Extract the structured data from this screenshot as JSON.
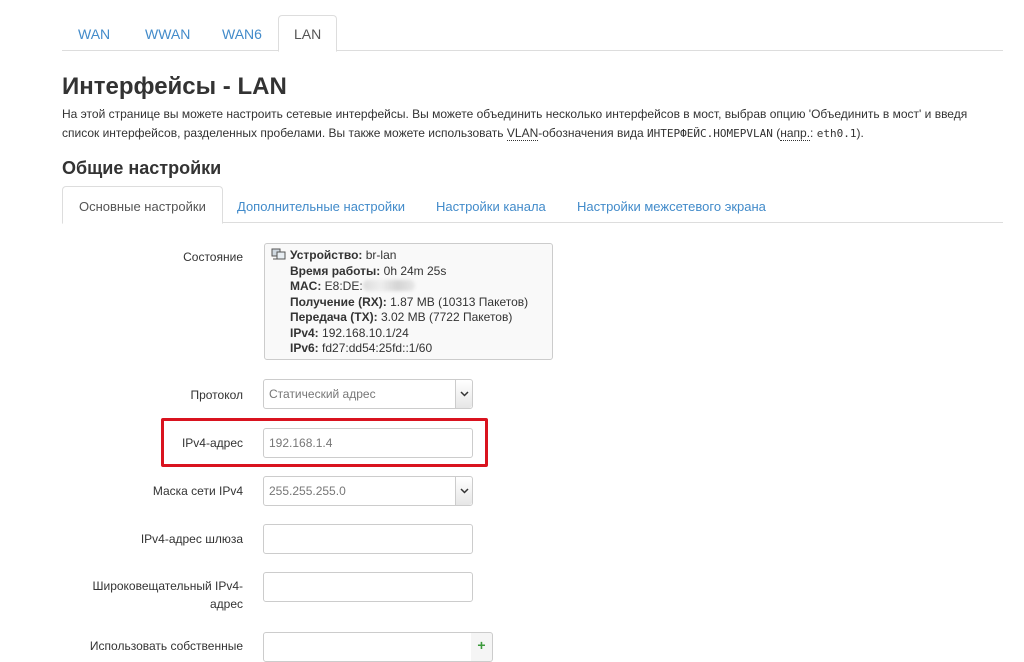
{
  "top_tabs": [
    "WAN",
    "WWAN",
    "WAN6",
    "LAN"
  ],
  "title": "Интерфейсы - LAN",
  "description": {
    "part1": "На этой странице вы можете настроить сетевые интерфейсы. Вы можете объединить несколько интерфейсов в мост, выбрав опцию 'Объединить в мост' и введя список интерфейсов, разделенных пробелами. Вы также можете использовать ",
    "vlan": "VLAN",
    "part2": "-обозначения вида ",
    "code1": "ИНТЕРФЕЙС.НОМЕРVLAN",
    "part3": " (",
    "example_abbr": "напр.",
    "part4": ": ",
    "code2": "eth0.1",
    "part5": ")."
  },
  "section_title": "Общие настройки",
  "sub_tabs": [
    "Основные настройки",
    "Дополнительные настройки",
    "Настройки канала",
    "Настройки межсетевого экрана"
  ],
  "status": {
    "label": "Состояние",
    "device_label": "Устройство:",
    "device": "br-lan",
    "uptime_label": "Время работы:",
    "uptime": "0h 24m 25s",
    "mac_label": "MAC:",
    "mac": "E8:DE:",
    "rx_label": "Получение (RX):",
    "rx": "1.87 MB (10313 Пакетов)",
    "tx_label": "Передача (TX):",
    "tx": "3.02 MB (7722 Пакетов)",
    "ipv4_label": "IPv4:",
    "ipv4": "192.168.10.1/24",
    "ipv6_label": "IPv6:",
    "ipv6": "fd27:dd54:25fd::1/60"
  },
  "protocol": {
    "label": "Протокол",
    "value": "Статический адрес"
  },
  "ipv4_address": {
    "label": "IPv4-адрес",
    "value": "192.168.1.4"
  },
  "netmask": {
    "label": "Маска сети IPv4",
    "value": "255.255.255.0"
  },
  "gateway": {
    "label": "IPv4-адрес шлюза",
    "value": ""
  },
  "broadcast": {
    "label_line1": "Широковещательный IPv4-",
    "label_line2": "адрес",
    "value": ""
  },
  "custom_dns": {
    "label": "Использовать собственные",
    "value": "",
    "add": "+"
  },
  "colors": {
    "link": "#428bca",
    "highlight": "#d9131f"
  }
}
